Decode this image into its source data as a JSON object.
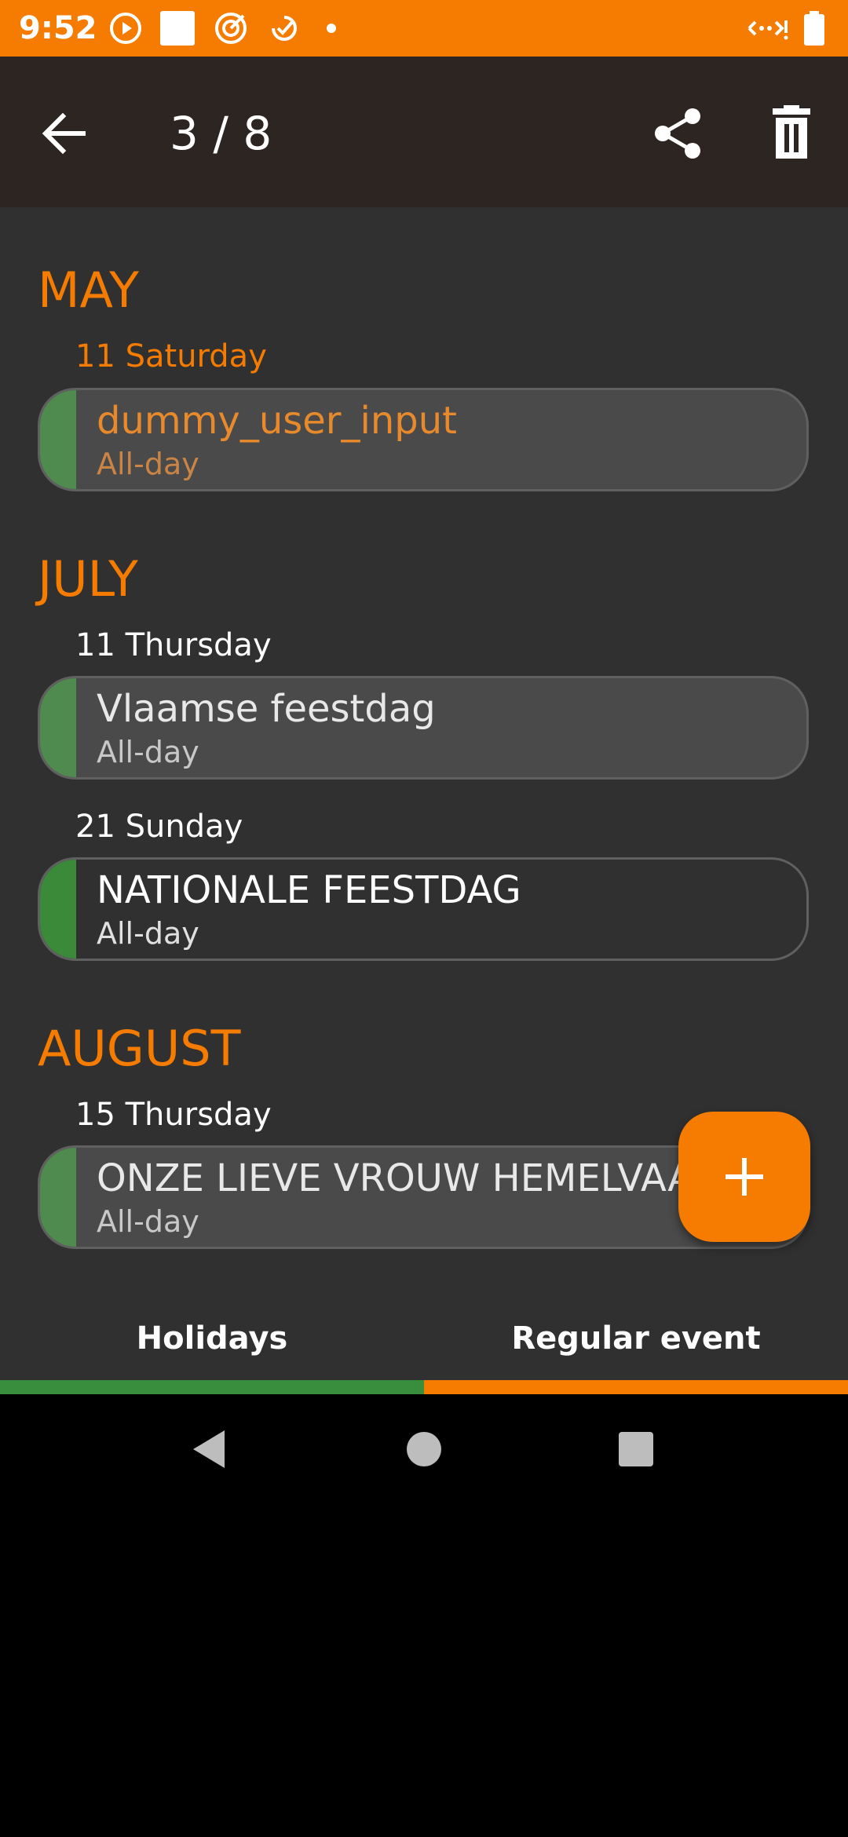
{
  "status_bar": {
    "time": "9:52",
    "icons": [
      "play-circle-icon",
      "square-icon",
      "target-icon",
      "check-badge-icon",
      "dot-icon",
      "signal-icon",
      "battery-icon"
    ]
  },
  "app_bar": {
    "counter": "3 / 8",
    "actions": [
      "back-arrow-icon",
      "share-icon",
      "trash-icon"
    ]
  },
  "sections": [
    {
      "month": "MAY",
      "days": [
        {
          "label": "11 Saturday",
          "events": [
            {
              "title": "dummy_user_input",
              "subtitle": "All-day"
            }
          ]
        }
      ]
    },
    {
      "month": "JULY",
      "days": [
        {
          "label": "11 Thursday",
          "events": [
            {
              "title": "Vlaamse feestdag",
              "subtitle": "All-day"
            }
          ]
        },
        {
          "label": "21 Sunday",
          "events": [
            {
              "title": "NATIONALE FEESTDAG",
              "subtitle": "All-day"
            }
          ]
        }
      ]
    },
    {
      "month": "AUGUST",
      "days": [
        {
          "label": "15 Thursday",
          "events": [
            {
              "title": "ONZE LIEVE VROUW HEMELVAART",
              "subtitle": "All-day"
            }
          ]
        }
      ]
    }
  ],
  "fab": {
    "icon": "plus-icon"
  },
  "tabs": [
    {
      "label": "Holidays",
      "color": "#388e3c"
    },
    {
      "label": "Regular event",
      "color": "#f57c00"
    }
  ],
  "colors": {
    "accent": "#f57c00",
    "app_bar": "#2d2521",
    "background": "#303030",
    "holiday_green": "#4f8a4f"
  }
}
